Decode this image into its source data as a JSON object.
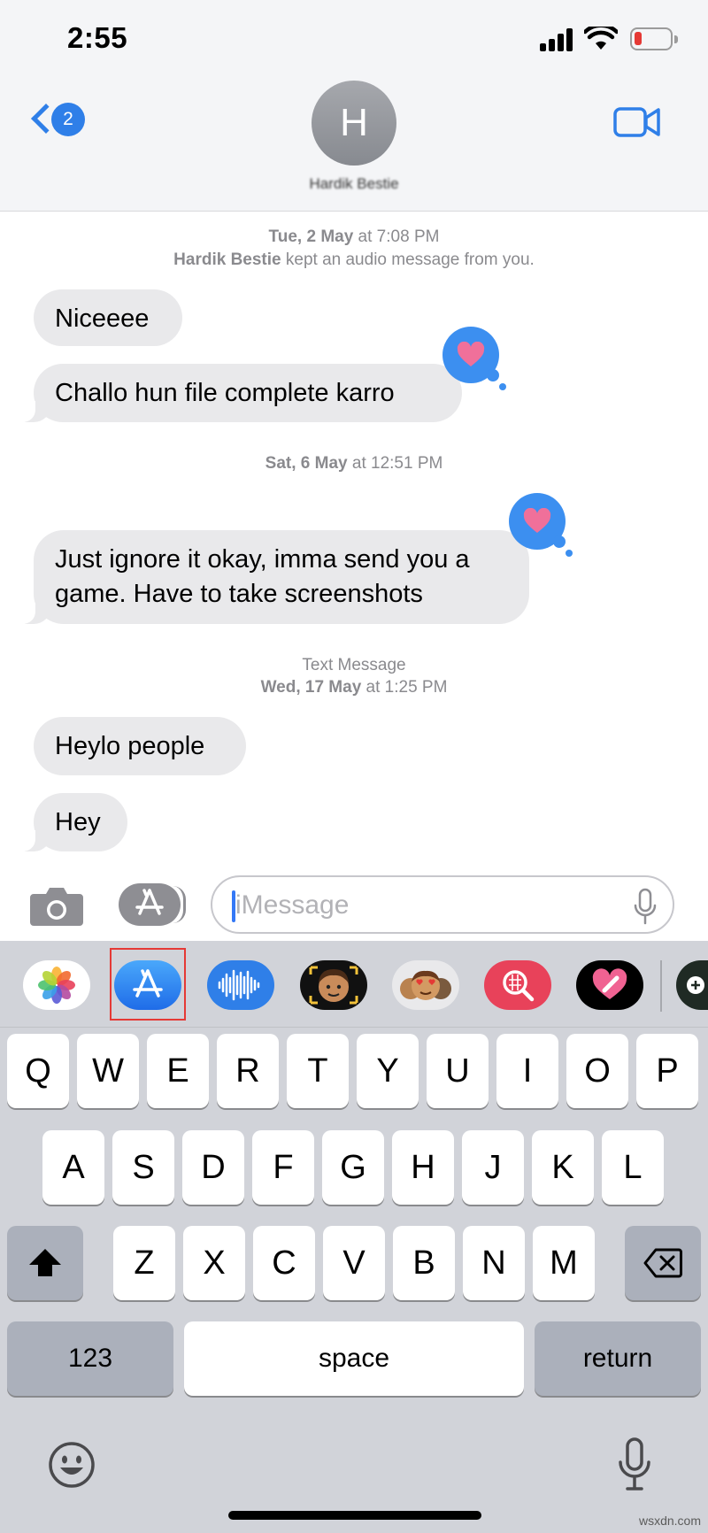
{
  "status_bar": {
    "time": "2:55"
  },
  "header": {
    "back_badge": "2",
    "avatar_initial": "H",
    "contact_name": "Hardik Bestie"
  },
  "conversation": {
    "group1": {
      "timestamp_day": "Tue, 2 May",
      "timestamp_time": " at 7:08 PM",
      "notice_name": "Hardik Bestie",
      "notice_text": " kept an audio message from you."
    },
    "messages": [
      {
        "text": "Niceeee"
      },
      {
        "text": "Challo hun file complete karro"
      },
      {
        "text": "Just ignore it okay, imma send you a game. Have to take screenshots"
      },
      {
        "text": "Heylo people"
      },
      {
        "text": "Hey"
      }
    ],
    "group2": {
      "timestamp_day": "Sat, 6 May",
      "timestamp_time": " at 12:51 PM"
    },
    "group3": {
      "label": "Text Message",
      "timestamp_day": "Wed, 17 May",
      "timestamp_time": " at 1:25 PM"
    }
  },
  "input": {
    "placeholder": "iMessage"
  },
  "app_drawer": [
    {
      "name": "photos-app-icon"
    },
    {
      "name": "app-store-icon",
      "highlighted": true
    },
    {
      "name": "audio-message-icon"
    },
    {
      "name": "memoji-icon"
    },
    {
      "name": "memoji-stickers-icon"
    },
    {
      "name": "images-search-icon"
    },
    {
      "name": "digital-touch-icon"
    }
  ],
  "keyboard": {
    "row1": [
      "Q",
      "W",
      "E",
      "R",
      "T",
      "Y",
      "U",
      "I",
      "O",
      "P"
    ],
    "row2": [
      "A",
      "S",
      "D",
      "F",
      "G",
      "H",
      "J",
      "K",
      "L"
    ],
    "row3": [
      "Z",
      "X",
      "C",
      "V",
      "B",
      "N",
      "M"
    ],
    "numbers_label": "123",
    "space_label": "space",
    "return_label": "return"
  },
  "watermark": "wsxdn.com",
  "colors": {
    "accent_blue": "#2f7fe8",
    "bubble_gray": "#e9e9eb",
    "tapback_blue": "#3c8ff0",
    "heart_pink": "#f0709a",
    "highlight_red": "#e53935",
    "keyboard_bg": "#d1d3d9"
  }
}
